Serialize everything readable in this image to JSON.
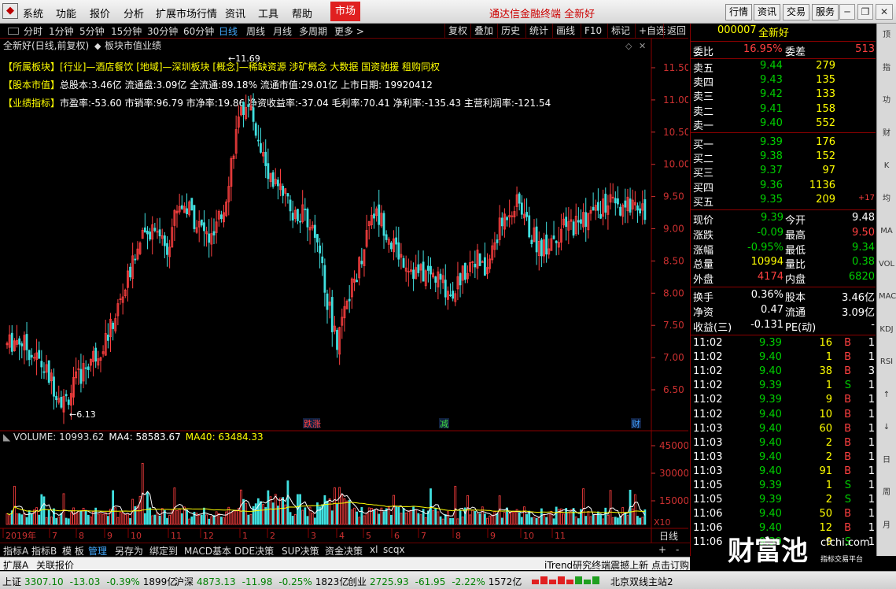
{
  "menu": {
    "items": [
      "系统",
      "功能",
      "报价",
      "分析",
      "扩展市场行情",
      "资讯",
      "工具",
      "帮助"
    ],
    "market": "市场",
    "app_title": "通达信金融终端",
    "stock_name_title": "全新好",
    "right_buttons": [
      "行情",
      "资讯",
      "交易",
      "服务"
    ]
  },
  "period": {
    "items": [
      "分时",
      "1分钟",
      "5分钟",
      "15分钟",
      "30分钟",
      "60分钟",
      "日线",
      "周线",
      "月线",
      "多周期",
      "更多 >"
    ],
    "active": "日线",
    "tools": [
      "复权",
      "叠加",
      "历史",
      "统计",
      "画线",
      "F10",
      "标记",
      "+自选",
      "返回"
    ]
  },
  "chart": {
    "title": "全新好(日线,前复权)",
    "subtitle": "板块市值业绩",
    "info": [
      {
        "label": "【所属板块】",
        "text": "[行业]—酒店餐饮 [地域]—深圳板块 [概念]—稀缺资源 涉矿概念 大数据 国资驰援 租购同权"
      },
      {
        "label": "【股本市值】",
        "text": "总股本:3.46亿 流通盘:3.09亿 全流通:89.18% 流通市值:29.01亿 上市日期: 19920412"
      },
      {
        "label": "【业绩指标】",
        "text": "市盈率:-53.60 市销率:96.79 市净率:19.86 净资收益率:-37.04 毛利率:70.41 净利率:-135.43 主营利润率:-121.54"
      }
    ],
    "high_mark": "11.69",
    "low_mark": "6.13",
    "price_ticks": [
      "11.50",
      "11.00",
      "10.50",
      "10.00",
      "9.50",
      "9.00",
      "8.50",
      "8.00",
      "7.50",
      "7.00",
      "6.50"
    ],
    "markers": [
      "跌涨",
      "减",
      "财"
    ],
    "volume_label": "VOLUME: 10993.62",
    "ma4_label": "MA4: 58583.67",
    "ma40_label": "MA40: 63484.33",
    "vol_ticks": [
      "45000",
      "30000",
      "15000"
    ],
    "vol_unit": "X10",
    "date_labels": [
      "2019年",
      "7",
      "8",
      "9",
      "10",
      "11",
      "12",
      "1",
      "2",
      "3",
      "4",
      "5",
      "6",
      "7",
      "8",
      "9",
      "10",
      "11"
    ],
    "period_label": "日线"
  },
  "tabs": {
    "items": [
      "指标A",
      "指标B",
      "模 板",
      "管理",
      "另存为",
      "绑定到",
      "MACD基本",
      "DDE决策",
      "SUP决策",
      "资金决策",
      "xl",
      "scqx"
    ],
    "active": "管理",
    "zoom": [
      "+",
      "-"
    ]
  },
  "bottom2": {
    "items": [
      "扩展A",
      "关联报价"
    ],
    "ticker": "iTrend研究终端震撼上新 点击订购"
  },
  "quote": {
    "code": "000007",
    "name": "全新好",
    "weibi_label": "委比",
    "weibi": "16.95%",
    "weicha_label": "委差",
    "weicha": "513",
    "asks": [
      {
        "l": "卖五",
        "p": "9.44",
        "v": "279"
      },
      {
        "l": "卖四",
        "p": "9.43",
        "v": "135"
      },
      {
        "l": "卖三",
        "p": "9.42",
        "v": "133"
      },
      {
        "l": "卖二",
        "p": "9.41",
        "v": "158"
      },
      {
        "l": "卖一",
        "p": "9.40",
        "v": "552"
      }
    ],
    "bids": [
      {
        "l": "买一",
        "p": "9.39",
        "v": "176",
        "x": ""
      },
      {
        "l": "买二",
        "p": "9.38",
        "v": "152",
        "x": ""
      },
      {
        "l": "买三",
        "p": "9.37",
        "v": "97",
        "x": ""
      },
      {
        "l": "买四",
        "p": "9.36",
        "v": "1136",
        "x": ""
      },
      {
        "l": "买五",
        "p": "9.35",
        "v": "209",
        "x": "+17"
      }
    ],
    "stats1": [
      {
        "l1": "现价",
        "v1": "9.39",
        "c1": "dn",
        "l2": "今开",
        "v2": "9.48",
        "c2": "wh"
      },
      {
        "l1": "涨跌",
        "v1": "-0.09",
        "c1": "dn",
        "l2": "最高",
        "v2": "9.50",
        "c2": "up"
      },
      {
        "l1": "涨幅",
        "v1": "-0.95%",
        "c1": "dn",
        "l2": "最低",
        "v2": "9.34",
        "c2": "dn"
      },
      {
        "l1": "总量",
        "v1": "10994",
        "c1": "yl",
        "l2": "量比",
        "v2": "0.38",
        "c2": "dn"
      },
      {
        "l1": "外盘",
        "v1": "4174",
        "c1": "up",
        "l2": "内盘",
        "v2": "6820",
        "c2": "dn"
      }
    ],
    "stats2": [
      {
        "l1": "换手",
        "v1": "0.36%",
        "l2": "股本",
        "v2": "3.46亿"
      },
      {
        "l1": "净资",
        "v1": "0.47",
        "l2": "流通",
        "v2": "3.09亿"
      },
      {
        "l1": "收益(三)",
        "v1": "-0.131",
        "l2": "PE(动)",
        "v2": "-"
      }
    ],
    "ticks": [
      [
        "11:02",
        "9.39",
        "16",
        "B",
        "1"
      ],
      [
        "11:02",
        "9.40",
        "1",
        "B",
        "1"
      ],
      [
        "11:02",
        "9.40",
        "38",
        "B",
        "3"
      ],
      [
        "11:02",
        "9.39",
        "1",
        "S",
        "1"
      ],
      [
        "11:02",
        "9.39",
        "9",
        "B",
        "1"
      ],
      [
        "11:02",
        "9.40",
        "10",
        "B",
        "1"
      ],
      [
        "11:03",
        "9.40",
        "60",
        "B",
        "1"
      ],
      [
        "11:03",
        "9.40",
        "2",
        "B",
        "1"
      ],
      [
        "11:03",
        "9.40",
        "2",
        "B",
        "1"
      ],
      [
        "11:03",
        "9.40",
        "91",
        "B",
        "1"
      ],
      [
        "11:05",
        "9.39",
        "1",
        "S",
        "1"
      ],
      [
        "11:05",
        "9.39",
        "2",
        "S",
        "1"
      ],
      [
        "11:06",
        "9.40",
        "50",
        "B",
        "1"
      ],
      [
        "11:06",
        "9.40",
        "12",
        "B",
        "1"
      ],
      [
        "11:06",
        "9.39",
        "9",
        "S",
        "1"
      ]
    ]
  },
  "side": {
    "items": [
      "顶",
      "指",
      "功",
      "财",
      "K",
      "均",
      "MA",
      "VOL",
      "MACD",
      "KDJ",
      "RSI",
      "↑",
      "↓",
      "日",
      "周",
      "月"
    ]
  },
  "status": {
    "items": [
      {
        "name": "上证",
        "price": "3307.10",
        "chg": "-13.03",
        "pct": "-0.39%",
        "amt": "1899亿"
      },
      {
        "name": "沪深",
        "price": "4873.13",
        "chg": "-11.98",
        "pct": "-0.25%",
        "amt": "1823亿"
      },
      {
        "name": "创业",
        "price": "2725.93",
        "chg": "-61.95",
        "pct": "-2.22%",
        "amt": "1572亿"
      }
    ],
    "server": "北京双线主站2"
  },
  "watermark": {
    "text": "财富池",
    "url": "cfchi.com",
    "sub": "指标交易平台"
  },
  "colors": {
    "up": "#ff4040",
    "down": "#00d000",
    "yellow": "#ffff00",
    "border": "#8a0000",
    "bg": "#000000"
  }
}
